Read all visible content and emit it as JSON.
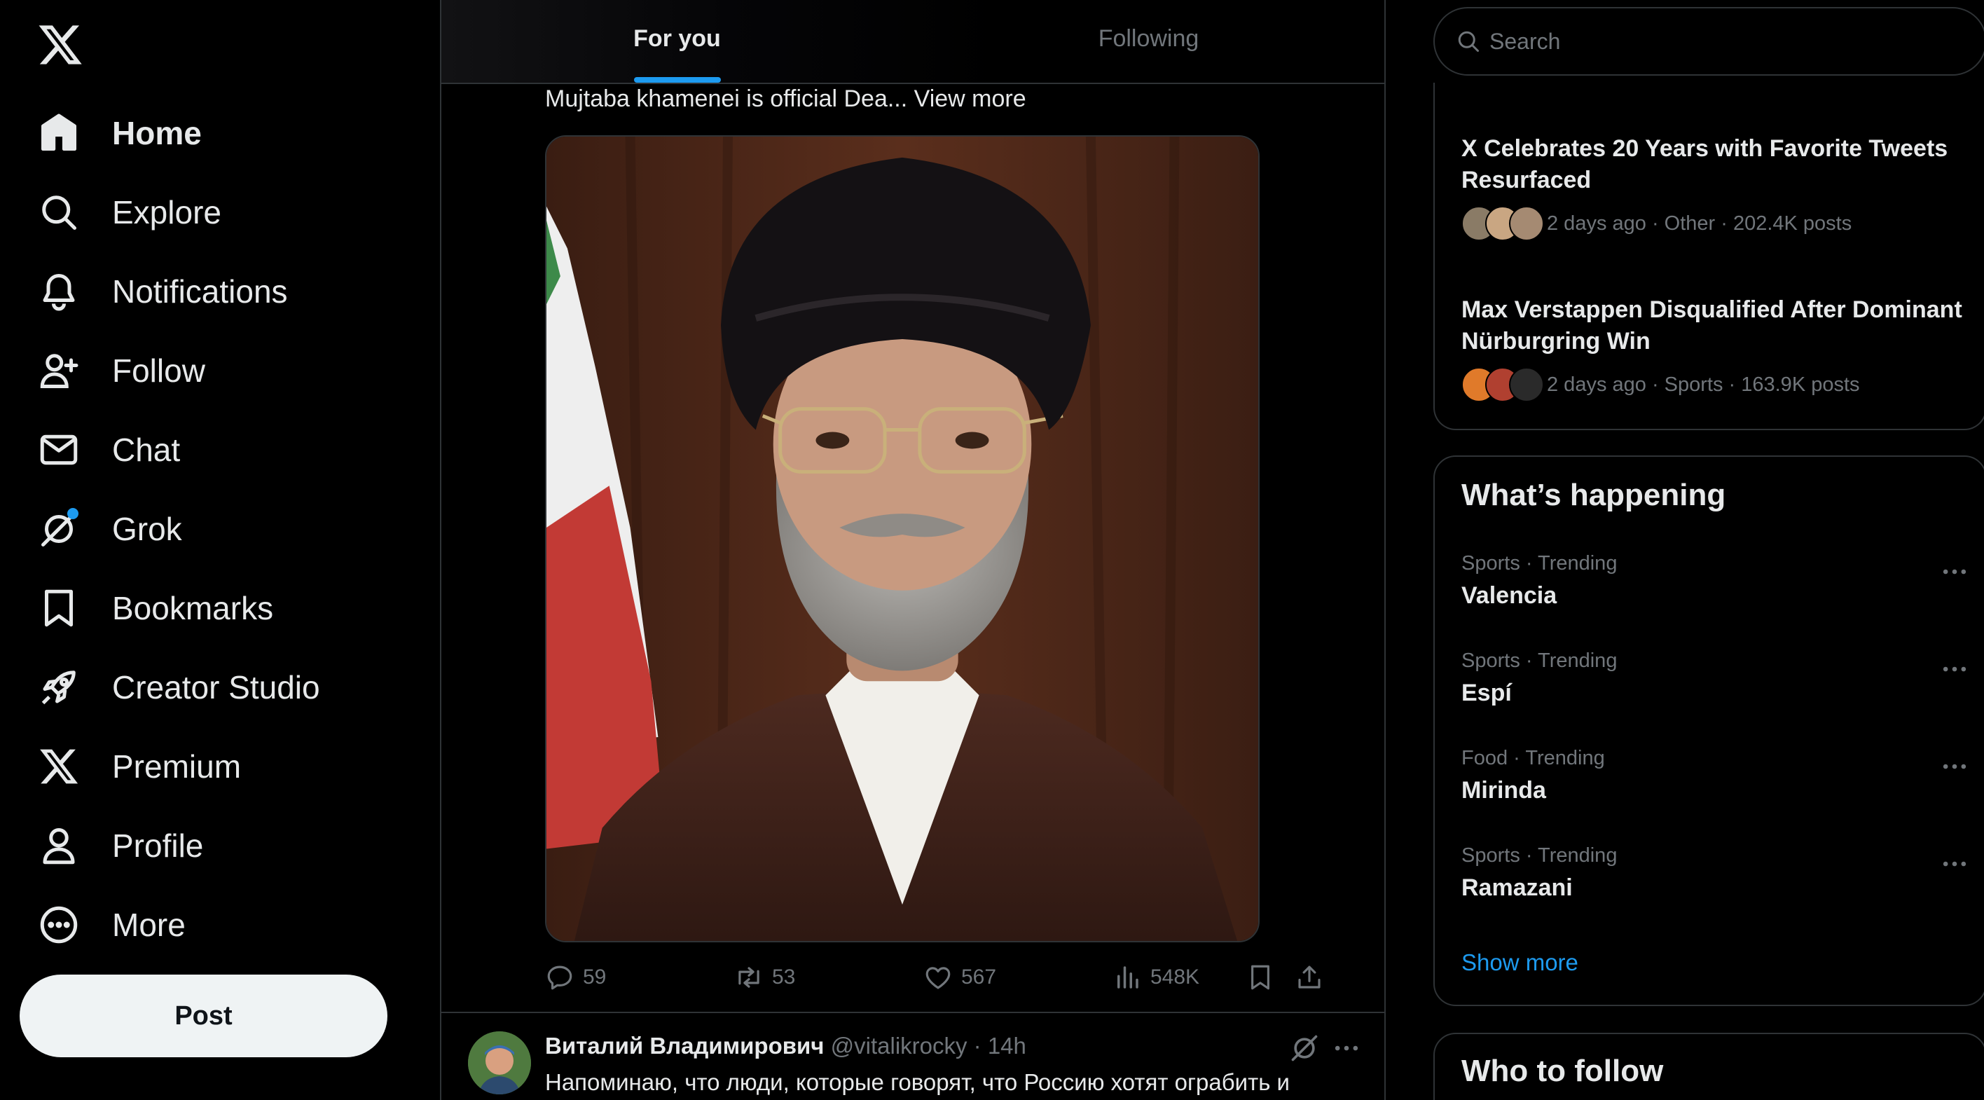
{
  "nav": {
    "items": [
      {
        "label": "Home",
        "icon": "home-icon"
      },
      {
        "label": "Explore",
        "icon": "search-icon"
      },
      {
        "label": "Notifications",
        "icon": "bell-icon"
      },
      {
        "label": "Follow",
        "icon": "person-add-icon"
      },
      {
        "label": "Chat",
        "icon": "envelope-icon"
      },
      {
        "label": "Grok",
        "icon": "grok-icon"
      },
      {
        "label": "Bookmarks",
        "icon": "bookmark-icon"
      },
      {
        "label": "Creator Studio",
        "icon": "rocket-icon"
      },
      {
        "label": "Premium",
        "icon": "x-logo-icon"
      },
      {
        "label": "Profile",
        "icon": "person-icon"
      },
      {
        "label": "More",
        "icon": "more-circle-icon"
      }
    ],
    "post_label": "Post"
  },
  "tabs": [
    {
      "label": "For you",
      "active": true
    },
    {
      "label": "Following",
      "active": false
    }
  ],
  "tweet": {
    "text": "Mujtaba khamenei is official Dea...",
    "view_more": "View more",
    "image_icon": "portrait-photo",
    "replies": "59",
    "reposts": "53",
    "likes": "567",
    "views": "548K"
  },
  "tweet2": {
    "name": "Виталий Владимирович",
    "handle_time": "@vitalikrocky · 14h",
    "body": "Напоминаю, что люди, которые говорят, что Россию хотят ограбить и"
  },
  "search": {
    "placeholder": "Search"
  },
  "news": [
    {
      "title": "X Celebrates 20 Years with Favorite Tweets Resurfaced",
      "meta": "2 days ago · Other · 202.4K posts"
    },
    {
      "title": "Max Verstappen Disqualified After Dominant Nürburgring Win",
      "meta": "2 days ago · Sports · 163.9K posts"
    }
  ],
  "happening": {
    "title": "What’s happening",
    "trends": [
      {
        "meta": "Sports · Trending",
        "name": "Valencia"
      },
      {
        "meta": "Sports · Trending",
        "name": "Espí"
      },
      {
        "meta": "Food · Trending",
        "name": "Mirinda"
      },
      {
        "meta": "Sports · Trending",
        "name": "Ramazani"
      }
    ],
    "show_more": "Show more"
  },
  "who_to_follow": {
    "title": "Who to follow"
  },
  "colors": {
    "accent": "#1d9bf0",
    "background": "#000000",
    "border": "#2f3336",
    "muted": "#71767b"
  }
}
